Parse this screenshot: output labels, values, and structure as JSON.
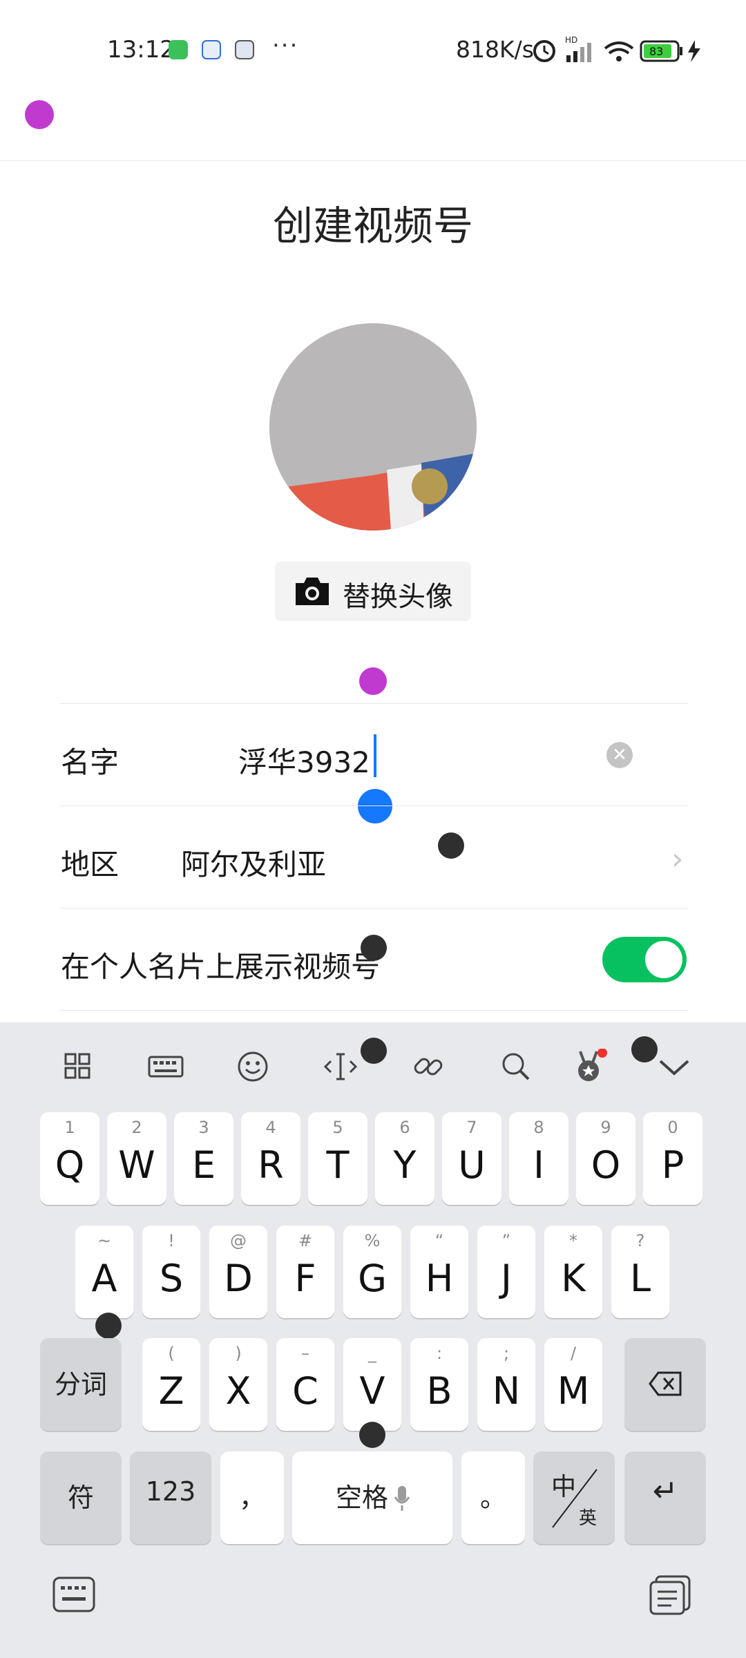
{
  "status_bar": {
    "time": "13:12",
    "more": "···",
    "speed": "818K/s",
    "hd": "HD",
    "battery": "83"
  },
  "page": {
    "title": "创建视频号",
    "replace_avatar_label": "替换头像"
  },
  "form": {
    "name": {
      "label": "名字",
      "value": "浮华3932",
      "clear_icon": "close-circle-icon"
    },
    "region": {
      "label": "地区",
      "value": "阿尔及利亚",
      "chevron": "›"
    },
    "show_on_card": {
      "label": "在个人名片上展示视频号",
      "enabled": true
    }
  },
  "keyboard": {
    "toolbar": [
      "grid-icon",
      "keyboard-layout-icon",
      "emoji-icon",
      "text-cursor-icon",
      "link-icon",
      "search-icon",
      "badge-icon",
      "chevron-down-icon"
    ],
    "row1": [
      {
        "key": "Q",
        "sym": "1"
      },
      {
        "key": "W",
        "sym": "2"
      },
      {
        "key": "E",
        "sym": "3"
      },
      {
        "key": "R",
        "sym": "4"
      },
      {
        "key": "T",
        "sym": "5"
      },
      {
        "key": "Y",
        "sym": "6"
      },
      {
        "key": "U",
        "sym": "7"
      },
      {
        "key": "I",
        "sym": "8"
      },
      {
        "key": "O",
        "sym": "9"
      },
      {
        "key": "P",
        "sym": "0"
      }
    ],
    "row2": [
      {
        "key": "A",
        "sym": "~"
      },
      {
        "key": "S",
        "sym": "!"
      },
      {
        "key": "D",
        "sym": "@"
      },
      {
        "key": "F",
        "sym": "#"
      },
      {
        "key": "G",
        "sym": "%"
      },
      {
        "key": "H",
        "sym": "“"
      },
      {
        "key": "J",
        "sym": "”"
      },
      {
        "key": "K",
        "sym": "*"
      },
      {
        "key": "L",
        "sym": "?"
      }
    ],
    "row3": [
      {
        "key": "Z",
        "sym": "("
      },
      {
        "key": "X",
        "sym": ")"
      },
      {
        "key": "C",
        "sym": "–"
      },
      {
        "key": "V",
        "sym": "_"
      },
      {
        "key": "B",
        "sym": ":"
      },
      {
        "key": "N",
        "sym": ";"
      },
      {
        "key": "M",
        "sym": "/"
      }
    ],
    "segment_label": "分词",
    "symbols_label": "符",
    "numbers_label": "123",
    "comma": "，",
    "space_label": "空格",
    "period": "。",
    "lang_top": "中",
    "lang_bottom": "英",
    "enter": "↵"
  },
  "colors": {
    "accent": "#1677ff",
    "toggle_on": "#07c160",
    "marker_purple": "#c03ad0",
    "marker_dark": "#2f2f2f"
  }
}
